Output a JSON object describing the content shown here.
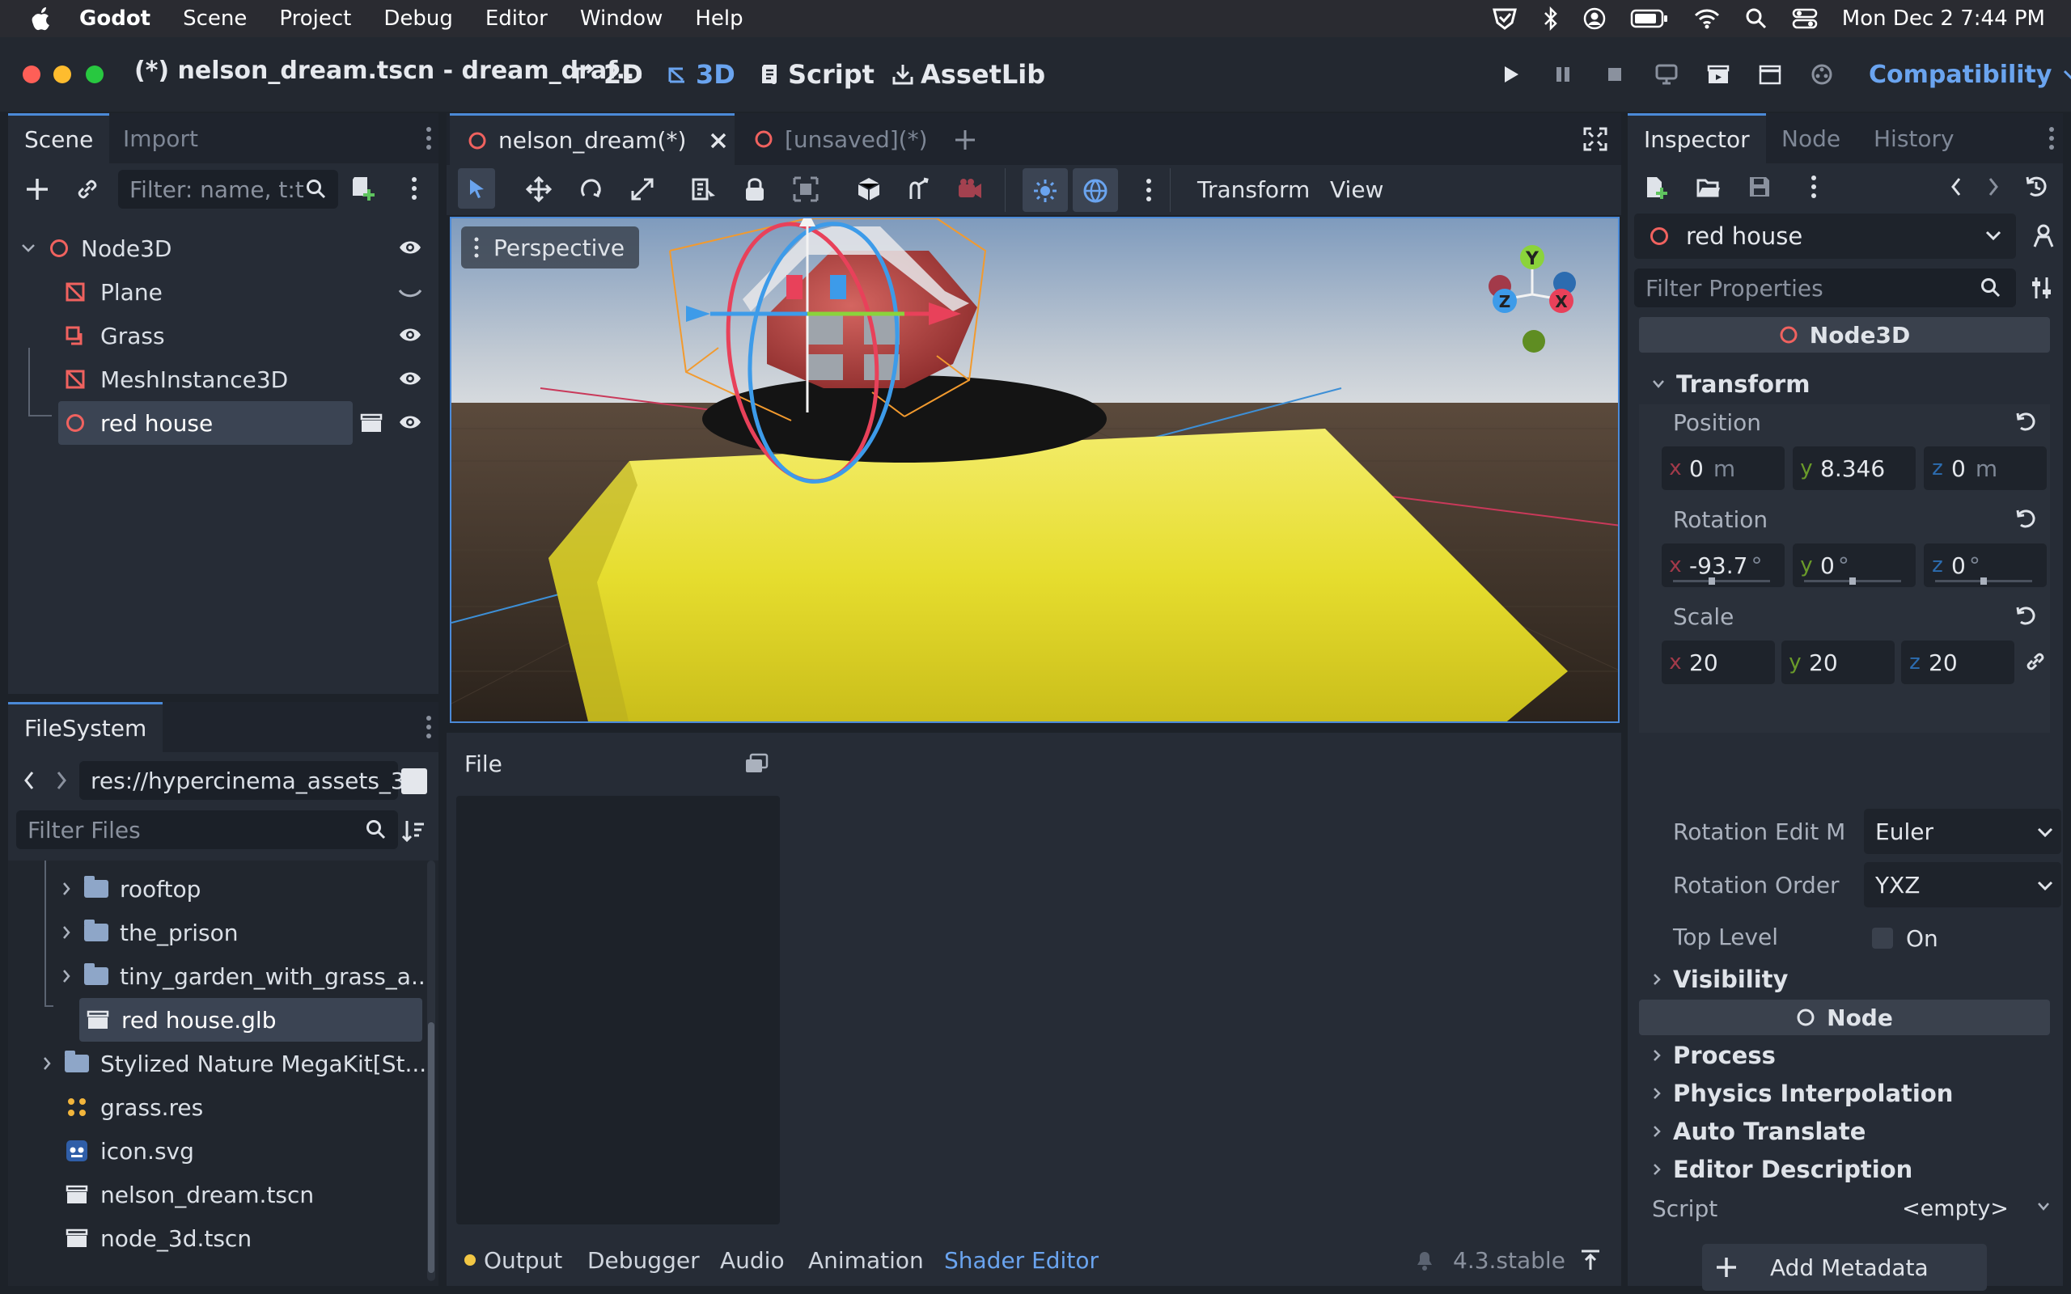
{
  "menubar": {
    "app": "Godot",
    "items": [
      "Scene",
      "Project",
      "Debug",
      "Editor",
      "Window",
      "Help"
    ],
    "datetime": "Mon Dec 2  7:44 PM"
  },
  "window": {
    "title": "(*) nelson_dream.tscn - dream_draf...",
    "main_tabs": [
      "2D",
      "3D",
      "Script",
      "AssetLib"
    ],
    "renderer": "Compatibility"
  },
  "scene_panel": {
    "tabs": [
      "Scene",
      "Import"
    ],
    "filter_placeholder": "Filter: name, t:t",
    "nodes": [
      "Node3D",
      "Plane",
      "Grass",
      "MeshInstance3D",
      "red house"
    ]
  },
  "filesystem": {
    "tab": "FileSystem",
    "path": "res://hypercinema_assets_3",
    "filter_placeholder": "Filter Files",
    "items": [
      {
        "name": "rooftop",
        "type": "folder"
      },
      {
        "name": "the_prison",
        "type": "folder"
      },
      {
        "name": "tiny_garden_with_grass_a...",
        "type": "folder"
      },
      {
        "name": "red house.glb",
        "type": "scene"
      },
      {
        "name": "Stylized Nature MegaKit[St...",
        "type": "folder"
      },
      {
        "name": "grass.res",
        "type": "resource"
      },
      {
        "name": "icon.svg",
        "type": "image"
      },
      {
        "name": "nelson_dream.tscn",
        "type": "scene"
      },
      {
        "name": "node_3d.tscn",
        "type": "scene"
      }
    ]
  },
  "editor_tabs": [
    "nelson_dream(*)",
    "[unsaved](*)"
  ],
  "viewport": {
    "toolbar_menus": [
      "Transform",
      "View"
    ],
    "perspective_label": "Perspective",
    "gizmo_axes": [
      "Y",
      "Z",
      "X"
    ]
  },
  "bottom": {
    "file_label": "File",
    "tabs": [
      "Output",
      "Debugger",
      "Audio",
      "Animation",
      "Shader Editor"
    ],
    "version": "4.3.stable"
  },
  "inspector": {
    "tabs": [
      "Inspector",
      "Node",
      "History"
    ],
    "object": "red house",
    "filter_placeholder": "Filter Properties",
    "class_node3d": "Node3D",
    "transform_label": "Transform",
    "position_label": "Position",
    "position": {
      "x": "0",
      "x_unit": "m",
      "y": "8.346",
      "z": "0",
      "z_unit": "m"
    },
    "rotation_label": "Rotation",
    "rotation": {
      "x": "-93.7",
      "y": "0",
      "z": "0",
      "unit": "°"
    },
    "scale_label": "Scale",
    "scale": {
      "x": "20",
      "y": "20",
      "z": "20"
    },
    "rotation_edit_label": "Rotation Edit M",
    "rotation_edit_value": "Euler",
    "rotation_order_label": "Rotation Order",
    "rotation_order_value": "YXZ",
    "top_level_label": "Top Level",
    "top_level_value": "On",
    "visibility_label": "Visibility",
    "class_node": "Node",
    "sections": [
      "Process",
      "Physics Interpolation",
      "Auto Translate",
      "Editor Description"
    ],
    "script_label": "Script",
    "script_value": "<empty>",
    "add_metadata": "Add Metadata",
    "axis_labels": [
      "x",
      "y",
      "z"
    ]
  },
  "colors": {
    "accent": "#4b8ad8",
    "axis_x": "#e8415a",
    "axis_y": "#8bd33b",
    "axis_z": "#3d9be9",
    "node_ring": "#f0625f"
  }
}
